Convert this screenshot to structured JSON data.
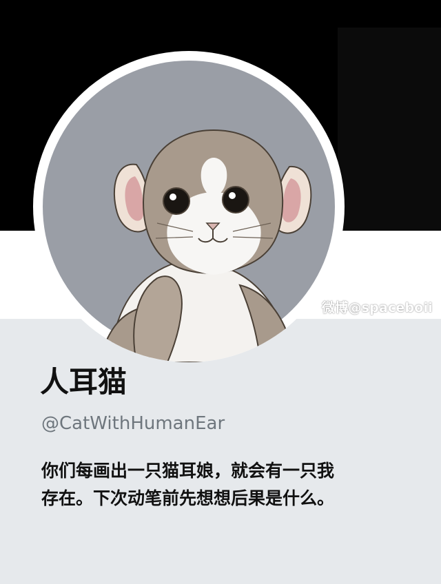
{
  "profile": {
    "display_name": "人耳猫",
    "handle": "@CatWithHumanEar",
    "bio_line1": "你们每画出一只猫耳娘，就会有一只我",
    "bio_line2": "存在。下次动笔前先想想后果是什么。"
  },
  "watermark": {
    "text": "微博@spaceboii"
  },
  "avatar": {
    "icon": "cat-with-human-ears-avatar"
  },
  "colors": {
    "banner": "#000000",
    "profile_background": "#e6e9ec",
    "handle_text": "#6e767d",
    "primary_text": "#111111",
    "avatar_background": "#9a9ea6"
  }
}
